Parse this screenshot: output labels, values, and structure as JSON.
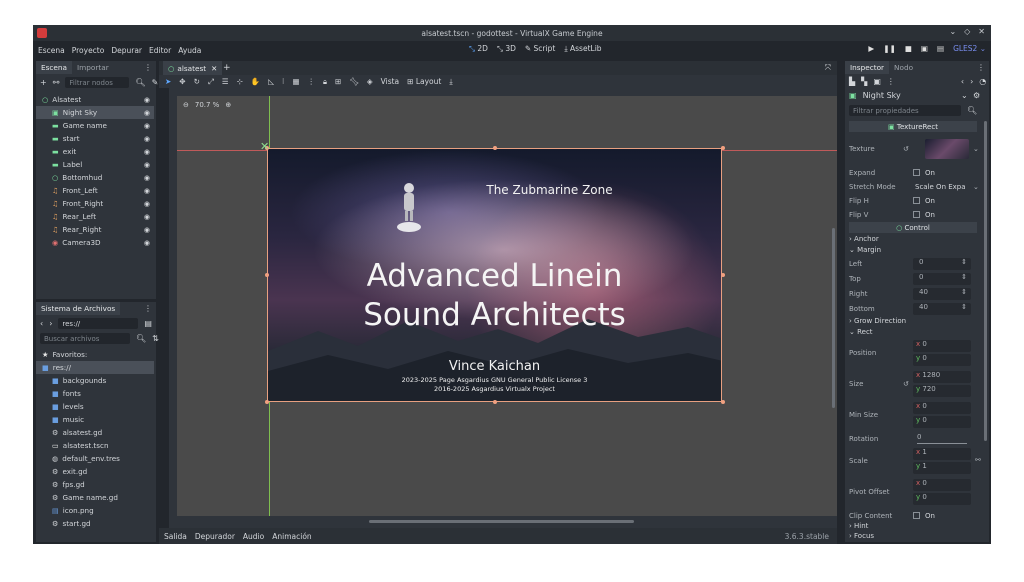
{
  "window": {
    "title": "alsatest.tscn - godottest - VirtualX Game Engine"
  },
  "menubar": {
    "menus": [
      "Escena",
      "Proyecto",
      "Depurar",
      "Editor",
      "Ayuda"
    ],
    "modes": [
      "2D",
      "3D",
      "Script",
      "AssetLib"
    ],
    "active_mode": "2D",
    "renderer": "GLES2"
  },
  "scene_panel": {
    "tabs": [
      "Escena",
      "Importar"
    ],
    "filter_placeholder": "Filtrar nodos",
    "nodes": [
      {
        "label": "Alsatest",
        "icon": "control-icon",
        "depth": 0,
        "selected": false
      },
      {
        "label": "Night Sky",
        "icon": "texture-rect-icon",
        "depth": 1,
        "selected": true
      },
      {
        "label": "Game name",
        "icon": "label-icon",
        "depth": 1,
        "selected": false
      },
      {
        "label": "start",
        "icon": "button-icon",
        "depth": 1,
        "selected": false
      },
      {
        "label": "exit",
        "icon": "button-icon",
        "depth": 1,
        "selected": false
      },
      {
        "label": "Label",
        "icon": "label-icon",
        "depth": 1,
        "selected": false
      },
      {
        "label": "Bottomhud",
        "icon": "control-icon",
        "depth": 1,
        "selected": false
      },
      {
        "label": "Front_Left",
        "icon": "audio-icon",
        "depth": 1,
        "selected": false
      },
      {
        "label": "Front_Right",
        "icon": "audio-icon",
        "depth": 1,
        "selected": false
      },
      {
        "label": "Rear_Left",
        "icon": "audio-icon",
        "depth": 1,
        "selected": false
      },
      {
        "label": "Rear_Right",
        "icon": "audio-icon",
        "depth": 1,
        "selected": false
      },
      {
        "label": "Camera3D",
        "icon": "camera-icon",
        "depth": 1,
        "selected": false
      }
    ]
  },
  "filesystem": {
    "title": "Sistema de Archivos",
    "path": "res://",
    "search_placeholder": "Buscar archivos",
    "items": [
      {
        "label": "Favoritos:",
        "icon": "star-icon",
        "depth": 0,
        "selected": false
      },
      {
        "label": "res://",
        "icon": "folder-icon",
        "depth": 0,
        "selected": true
      },
      {
        "label": "backgounds",
        "icon": "folder-icon",
        "depth": 1,
        "selected": false
      },
      {
        "label": "fonts",
        "icon": "folder-icon",
        "depth": 1,
        "selected": false
      },
      {
        "label": "levels",
        "icon": "folder-icon",
        "depth": 1,
        "selected": false
      },
      {
        "label": "music",
        "icon": "folder-icon",
        "depth": 1,
        "selected": false
      },
      {
        "label": "alsatest.gd",
        "icon": "gear-icon",
        "depth": 1,
        "selected": false
      },
      {
        "label": "alsatest.tscn",
        "icon": "scene-icon",
        "depth": 1,
        "selected": false
      },
      {
        "label": "default_env.tres",
        "icon": "resource-icon",
        "depth": 1,
        "selected": false
      },
      {
        "label": "exit.gd",
        "icon": "gear-icon",
        "depth": 1,
        "selected": false
      },
      {
        "label": "fps.gd",
        "icon": "gear-icon",
        "depth": 1,
        "selected": false
      },
      {
        "label": "Game name.gd",
        "icon": "gear-icon",
        "depth": 1,
        "selected": false
      },
      {
        "label": "icon.png",
        "icon": "image-icon",
        "depth": 1,
        "selected": false
      },
      {
        "label": "start.gd",
        "icon": "gear-icon",
        "depth": 1,
        "selected": false
      }
    ]
  },
  "editor": {
    "tab": "alsatest",
    "zoom": "70.7 %",
    "toolbar": {
      "vista": "Vista",
      "layout": "Layout"
    },
    "scene_text": {
      "subtitle": "The Zubmarine Zone",
      "title_line1": "Advanced Linein",
      "title_line2": "Sound Architects",
      "author": "Vince Kaichan",
      "license1": "2023-2025 Page Asgardius GNU General Public License 3",
      "license2": "2016-2025 Asgardius Virtualx Project"
    }
  },
  "bottom_bar": {
    "tabs": [
      "Salida",
      "Depurador",
      "Audio",
      "Animación"
    ],
    "version": "3.6.3.stable"
  },
  "inspector": {
    "tabs": [
      "Inspector",
      "Nodo"
    ],
    "node": "Night Sky",
    "filter_placeholder": "Filtrar propiedades",
    "class_header": "TextureRect",
    "control_header": "Control",
    "texture_label": "Texture",
    "expand": {
      "label": "Expand",
      "value": "On"
    },
    "stretch_mode": {
      "label": "Stretch Mode",
      "value": "Scale On Expa"
    },
    "flip_h": {
      "label": "Flip H",
      "value": "On"
    },
    "flip_v": {
      "label": "Flip V",
      "value": "On"
    },
    "anchor": "Anchor",
    "margin": "Margin",
    "margins": [
      {
        "label": "Left",
        "value": "0"
      },
      {
        "label": "Top",
        "value": "0"
      },
      {
        "label": "Right",
        "value": "40"
      },
      {
        "label": "Bottom",
        "value": "40"
      }
    ],
    "grow_direction": "Grow Direction",
    "rect": "Rect",
    "position": {
      "label": "Position",
      "x": "0",
      "y": "0"
    },
    "size": {
      "label": "Size",
      "x": "1280",
      "y": "720"
    },
    "min_size": {
      "label": "Min Size",
      "x": "0",
      "y": "0"
    },
    "rotation": {
      "label": "Rotation",
      "value": "0"
    },
    "scale": {
      "label": "Scale",
      "x": "1",
      "y": "1"
    },
    "pivot_offset": {
      "label": "Pivot Offset",
      "x": "0",
      "y": "0"
    },
    "clip_content": {
      "label": "Clip Content",
      "value": "On"
    },
    "hint": "Hint",
    "focus": "Focus"
  },
  "colors": {
    "accent": "#5fa8ff",
    "selection_outline": "#e8a080",
    "bg": "#22262c",
    "panel": "#2f343b"
  }
}
